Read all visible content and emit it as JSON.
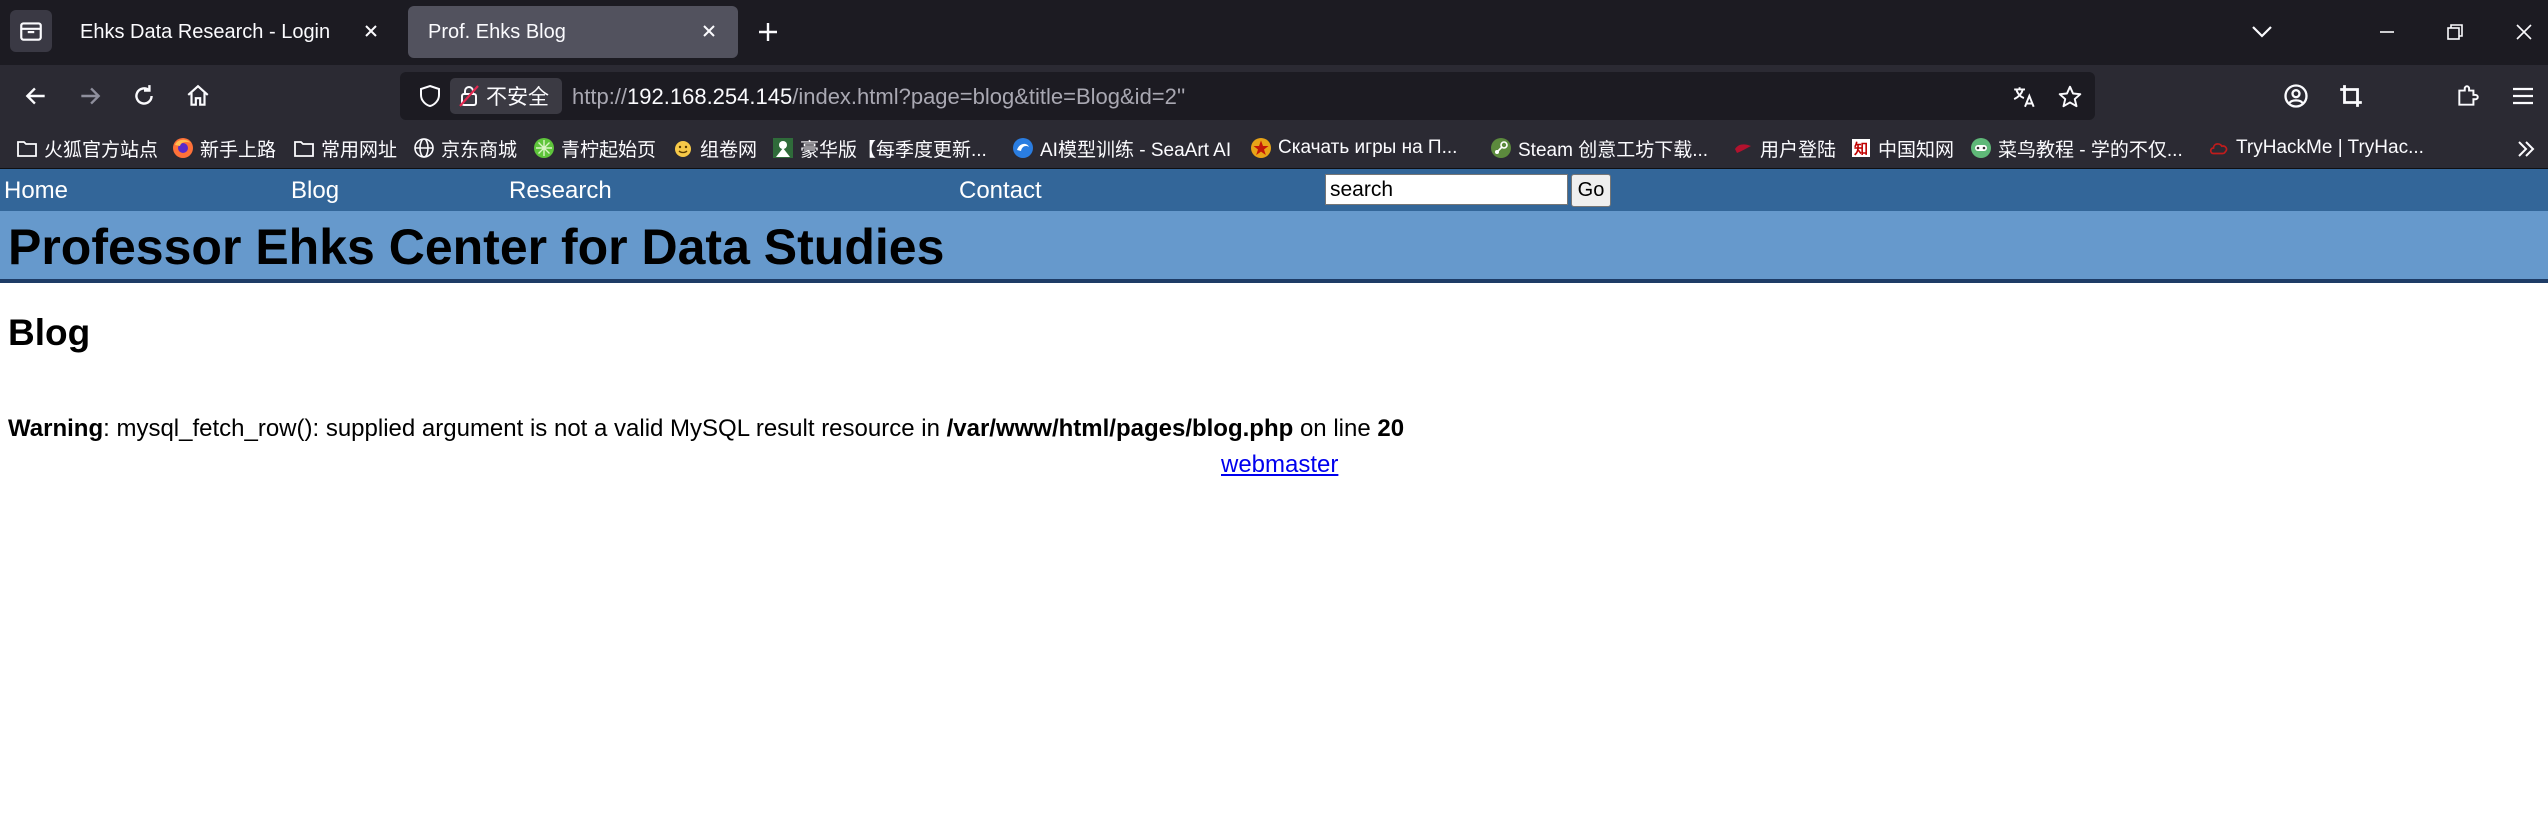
{
  "browser": {
    "tabs": [
      {
        "title": "Ehks Data Research - Login",
        "active": false
      },
      {
        "title": "Prof. Ehks Blog",
        "active": true
      }
    ],
    "url": {
      "scheme": "http://",
      "host": "192.168.254.145",
      "path": "/index.html?page=blog&title=Blog&id=2''"
    },
    "security_label": "不安全",
    "bookmarks": [
      {
        "label": "火狐官方站点",
        "icon": "folder-icon"
      },
      {
        "label": "新手上路",
        "icon": "firefox-icon"
      },
      {
        "label": "常用网址",
        "icon": "folder-icon"
      },
      {
        "label": "京东商城",
        "icon": "globe-icon"
      },
      {
        "label": "青柠起始页",
        "icon": "lime-icon"
      },
      {
        "label": "组卷网",
        "icon": "smiley-icon"
      },
      {
        "label": "豪华版【每季度更新...",
        "icon": "game-icon"
      },
      {
        "label": "AI模型训练 - SeaArt AI",
        "icon": "seaart-icon"
      },
      {
        "label": "Скачать игры на П...",
        "icon": "star-badge-icon"
      },
      {
        "label": "Steam 创意工坊下载...",
        "icon": "steam-icon"
      },
      {
        "label": "用户登陆",
        "icon": "red-icon"
      },
      {
        "label": "中国知网",
        "icon": "cnki-icon"
      },
      {
        "label": "菜鸟教程 - 学的不仅...",
        "icon": "runoob-icon"
      },
      {
        "label": "TryHackMe | TryHac...",
        "icon": "cloud-icon"
      }
    ]
  },
  "site": {
    "nav": [
      "Home",
      "Blog",
      "Research",
      "Contact"
    ],
    "search": {
      "value": "search",
      "button": "Go"
    },
    "title": "Professor Ehks Center for Data Studies"
  },
  "content": {
    "heading": "Blog",
    "warning": {
      "label": "Warning",
      "message": ": mysql_fetch_row(): supplied argument is not a valid MySQL result resource in ",
      "file": "/var/www/html/pages/blog.php",
      "on_line": " on line ",
      "line": "20"
    },
    "link": "webmaster"
  },
  "colors": {
    "nav_bg": "#336699",
    "banner_bg": "#6699cc",
    "link": "#0000ee"
  }
}
